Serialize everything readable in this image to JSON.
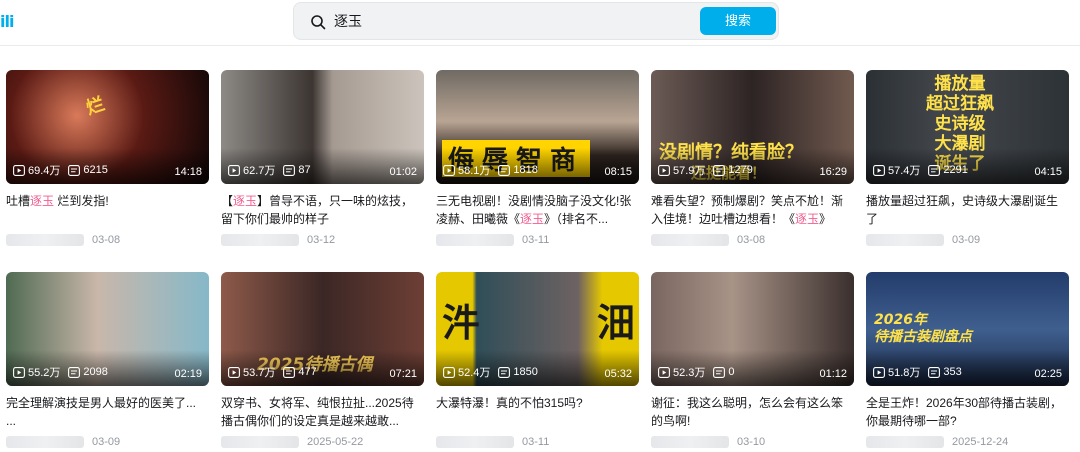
{
  "header": {
    "logo_text": "ili",
    "search_value": "逐玉",
    "search_button": "搜索"
  },
  "videos": [
    {
      "views": "69.4万",
      "danmaku": "6215",
      "duration": "14:18",
      "title_pre": "吐槽",
      "title_hl": "逐玉",
      "title_post": " 烂到发指!",
      "date": "03-08",
      "caption": "烂"
    },
    {
      "views": "62.7万",
      "danmaku": "87",
      "duration": "01:02",
      "title_pre": "【",
      "title_hl": "逐玉",
      "title_post": "】曾导不语，只一味的炫技，留下你们最帅的样子",
      "date": "03-12",
      "caption": ""
    },
    {
      "views": "58.1万",
      "danmaku": "1818",
      "duration": "08:15",
      "title_pre": "三无电视剧！没剧情没脑子没文化!张凌赫、田曦薇《",
      "title_hl": "逐玉",
      "title_post": "》（排名不...",
      "date": "03-11",
      "caption": "侮辱智商"
    },
    {
      "views": "57.9万",
      "danmaku": "1279",
      "duration": "16:29",
      "title_pre": "难看失望？预制爆剧？笑点不尬！渐入佳境！边吐槽边想看！《",
      "title_hl": "逐玉",
      "title_post": "》",
      "date": "03-08",
      "caption": "没剧情？纯看脸？",
      "caption2": "还挺能看！"
    },
    {
      "views": "57.4万",
      "danmaku": "2291",
      "duration": "04:15",
      "title_pre": "播放量超过狂飙，史诗级大瀑剧诞生了",
      "title_hl": "",
      "title_post": "",
      "date": "03-09",
      "caption": "播放量\n超过狂飙\n史诗级\n大瀑剧\n诞生了"
    },
    {
      "views": "55.2万",
      "danmaku": "2098",
      "duration": "02:19",
      "title_pre": "完全理解演技是男人最好的医美了...",
      "title_hl": "",
      "title_post": "",
      "title_line2": "...",
      "date": "03-09",
      "caption": ""
    },
    {
      "views": "53.7万",
      "danmaku": "477",
      "duration": "07:21",
      "title_pre": "双穿书、女将军、纯恨拉扯...2025待播古偶你们的设定真是越来越敢...",
      "title_hl": "",
      "title_post": "",
      "date": "2025-05-22",
      "caption": "2025待播古偶"
    },
    {
      "views": "52.4万",
      "danmaku": "1850",
      "duration": "05:32",
      "title_pre": "大瀑特瀑！真的不怕315吗?",
      "title_hl": "",
      "title_post": "",
      "date": "03-11",
      "caption": "汼",
      "caption2": "沺"
    },
    {
      "views": "52.3万",
      "danmaku": "0",
      "duration": "01:12",
      "title_pre": "谢征：我这么聪明，怎么会有这么笨的鸟啊!",
      "title_hl": "",
      "title_post": "",
      "date": "03-10",
      "caption": ""
    },
    {
      "views": "51.8万",
      "danmaku": "353",
      "duration": "02:25",
      "title_pre": "全是王炸！2026年30部待播古装剧，你最期待哪一部?",
      "title_hl": "",
      "title_post": "",
      "date": "2025-12-24",
      "caption": "2026年\n待播古装剧盘点"
    }
  ],
  "colors": {
    "accent": "#00aeec",
    "highlight": "#f25d8e"
  }
}
